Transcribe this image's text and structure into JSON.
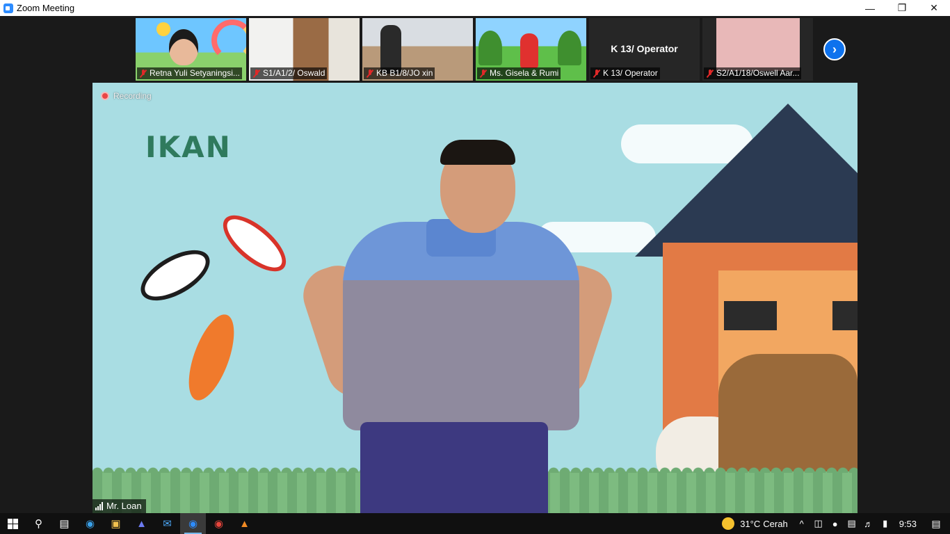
{
  "window": {
    "title": "Zoom Meeting",
    "minimize": "—",
    "restore": "❐",
    "close": "✕"
  },
  "participants": [
    {
      "name": "Retna Yuli Setyaningsi...",
      "muted": true
    },
    {
      "name": "S1/A1/2/ Oswald",
      "muted": true
    },
    {
      "name": "KB B1/8/JO xin",
      "muted": true
    },
    {
      "name": "Ms. Gisela & Rumi",
      "muted": true
    },
    {
      "name": "K 13/ Operator",
      "muted": true,
      "video_off": true
    },
    {
      "name": "S2/A1/18/Oswell Aar...",
      "muted": true
    }
  ],
  "next_page": "›",
  "main": {
    "recording": "Recording",
    "slide_word": "IKAN",
    "speaker": "Mr. Loan"
  },
  "taskbar": {
    "weather_temp": "31°C",
    "weather_text": "Cerah",
    "chevron": "^",
    "time": "9:53"
  },
  "colors": {
    "accent": "#0e72ed",
    "muted": "#e02828",
    "recording": "#e84545"
  }
}
